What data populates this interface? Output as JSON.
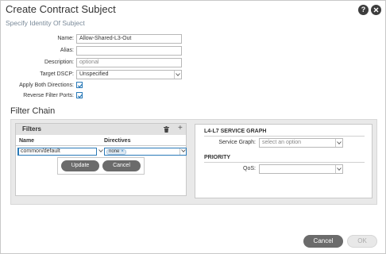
{
  "dialog": {
    "title": "Create Contract Subject",
    "subtitle": "Specify Identity Of Subject",
    "help_icon": "question-mark-icon",
    "close_icon": "close-icon"
  },
  "form": {
    "name": {
      "label": "Name:",
      "value": "Allow-Shared-L3-Out"
    },
    "alias": {
      "label": "Alias:",
      "value": ""
    },
    "description": {
      "label": "Description:",
      "placeholder": "optional"
    },
    "target_dscp": {
      "label": "Target DSCP:",
      "value": "Unspecified"
    },
    "apply_both_directions": {
      "label": "Apply Both Directions:",
      "checked": true
    },
    "reverse_filter_ports": {
      "label": "Reverse Filter Ports:",
      "checked": true
    }
  },
  "filter_chain": {
    "title": "Filter Chain",
    "filters": {
      "title": "Filters",
      "columns": [
        "Name",
        "Directives"
      ],
      "edit_row": {
        "name_value": "common/default",
        "directive_tag": "none",
        "directive_remove": "×"
      },
      "update_label": "Update",
      "cancel_label": "Cancel"
    },
    "service_graph": {
      "section_title": "L4-L7 SERVICE GRAPH",
      "label": "Service Graph:",
      "placeholder": "select an option"
    },
    "priority": {
      "section_title": "PRIORITY",
      "label": "QoS:",
      "value": ""
    }
  },
  "footer": {
    "cancel_label": "Cancel",
    "ok_label": "OK"
  },
  "colors": {
    "accent": "#2a7ab8",
    "button_dark": "#6b6b6b",
    "panel_bg": "#e9e9e9"
  }
}
